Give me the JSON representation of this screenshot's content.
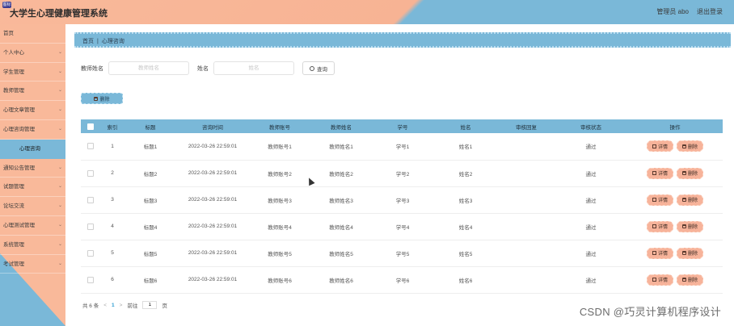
{
  "header": {
    "badge": "图标",
    "title": "大学生心理健康管理系统",
    "user_label": "管理员 abo",
    "logout_label": "退出登录"
  },
  "sidebar": {
    "items": [
      {
        "label": "首页",
        "chevron": false
      },
      {
        "label": "个人中心",
        "chevron": true
      },
      {
        "label": "学生管理",
        "chevron": true
      },
      {
        "label": "教师管理",
        "chevron": true
      },
      {
        "label": "心理文章管理",
        "chevron": true
      },
      {
        "label": "心理咨询管理",
        "chevron": true
      }
    ],
    "sub_item": "心理咨询",
    "items_after": [
      {
        "label": "通知公告管理",
        "chevron": true
      },
      {
        "label": "试题管理",
        "chevron": true
      },
      {
        "label": "论坛交流",
        "chevron": true
      },
      {
        "label": "心理测试管理",
        "chevron": true
      },
      {
        "label": "系统管理",
        "chevron": true
      },
      {
        "label": "考试管理",
        "chevron": true
      }
    ]
  },
  "breadcrumb": {
    "home": "首页",
    "separator": "|",
    "current": "心理咨询"
  },
  "search": {
    "teacher_label": "教师姓名",
    "teacher_placeholder": "教师姓名",
    "name_label": "姓名",
    "name_placeholder": "姓名",
    "query_label": "查询"
  },
  "batch_delete_label": "删除",
  "table": {
    "headers": [
      "",
      "索引",
      "标题",
      "咨询时间",
      "教师账号",
      "教师姓名",
      "学号",
      "姓名",
      "审核回复",
      "审核状态",
      "操作"
    ],
    "rows": [
      {
        "index": "1",
        "title": "标题1",
        "time": "2022-03-26 22:59:01",
        "account": "教师账号1",
        "teacher": "教师姓名1",
        "sid": "学号1",
        "name": "姓名1",
        "reply": "",
        "status": "通过"
      },
      {
        "index": "2",
        "title": "标题2",
        "time": "2022-03-26 22:59:01",
        "account": "教师账号2",
        "teacher": "教师姓名2",
        "sid": "学号2",
        "name": "姓名2",
        "reply": "",
        "status": "通过"
      },
      {
        "index": "3",
        "title": "标题3",
        "time": "2022-03-26 22:59:01",
        "account": "教师账号3",
        "teacher": "教师姓名3",
        "sid": "学号3",
        "name": "姓名3",
        "reply": "",
        "status": "通过"
      },
      {
        "index": "4",
        "title": "标题4",
        "time": "2022-03-26 22:59:01",
        "account": "教师账号4",
        "teacher": "教师姓名4",
        "sid": "学号4",
        "name": "姓名4",
        "reply": "",
        "status": "通过"
      },
      {
        "index": "5",
        "title": "标题5",
        "time": "2022-03-26 22:59:01",
        "account": "教师账号5",
        "teacher": "教师姓名5",
        "sid": "学号5",
        "name": "姓名5",
        "reply": "",
        "status": "通过"
      },
      {
        "index": "6",
        "title": "标题6",
        "time": "2022-03-26 22:59:01",
        "account": "教师账号6",
        "teacher": "教师姓名6",
        "sid": "学号6",
        "name": "姓名6",
        "reply": "",
        "status": "通过"
      }
    ],
    "detail_label": "详情",
    "delete_label": "删除"
  },
  "pager": {
    "total": "共 6 条",
    "prev": "<",
    "current": "1",
    "next": ">",
    "goto": "前往",
    "goto_value": "1",
    "page_suffix": "页"
  },
  "watermark": "CSDN @巧灵计算机程序设计",
  "colors": {
    "peach": "#f9b99a",
    "blue": "#7ab8d8",
    "active_page": "#2a9bd1"
  }
}
